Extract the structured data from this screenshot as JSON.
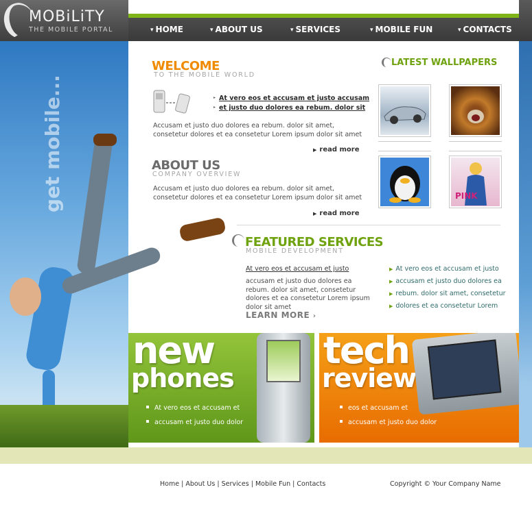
{
  "header": {
    "logo_title": "MOBiLiTY",
    "logo_subtitle": "THE MOBILE PORTAL",
    "nav": [
      {
        "label": "HOME"
      },
      {
        "label": "ABOUT US"
      },
      {
        "label": "SERVICES"
      },
      {
        "label": "MOBILE FUN"
      },
      {
        "label": "CONTACTS"
      }
    ]
  },
  "hero": {
    "vertical_text": "get mobile..."
  },
  "welcome": {
    "title": "WELCOME",
    "subtitle": "TO THE MOBILE WORLD",
    "links": [
      "At vero eos et accusam et justo accusam",
      "et justo duo dolores ea rebum. dolor sit"
    ],
    "body": "Accusam et justo duo dolores ea rebum. dolor sit amet, consetetur dolores et ea consetetur Lorem ipsum dolor sit amet",
    "read_more": "read more"
  },
  "about": {
    "title": "ABOUT US",
    "subtitle": "COMPANY OVERVIEW",
    "body": "Accusam et justo duo dolores ea rebum. dolor sit amet, consetetur dolores et ea consetetur Lorem ipsum dolor sit amet",
    "read_more": "read more"
  },
  "wallpapers": {
    "title": "LATEST WALLPAPERS",
    "items": [
      {
        "subject": "silver sports car"
      },
      {
        "subject": "roaring lion"
      },
      {
        "subject": "penguin"
      },
      {
        "subject": "woman in blue"
      }
    ]
  },
  "services": {
    "title": "FEATURED SERVICES",
    "subtitle": "MOBILE DEVELOPMENT",
    "link": "At vero eos et accusam et justo",
    "body": "accusam et justo duo dolores ea rebum. dolor sit amet, consetetur dolores et ea consetetur Lorem ipsum dolor sit amet",
    "learn_more": "LEARN MORE",
    "list": [
      "At vero eos et accusam et justo",
      "accusam et justo duo dolores ea",
      "rebum. dolor sit amet, consetetur",
      "dolores et ea consetetur Lorem"
    ]
  },
  "promos": {
    "new_phones": {
      "title": "new",
      "subtitle": "phones",
      "items": [
        "At vero eos et accusam et",
        "accusam et justo duo dolor"
      ]
    },
    "tech_review": {
      "title": "tech",
      "subtitle": "review",
      "items": [
        "eos et accusam et",
        "accusam et justo duo dolor"
      ]
    }
  },
  "footer": {
    "links": [
      "Home",
      "About Us",
      "Services",
      "Mobile Fun",
      "Contacts"
    ],
    "copyright": "Copyright © Your Company Name"
  },
  "colors": {
    "accent_green": "#7fb519",
    "accent_orange": "#f08a00",
    "header_gray": "#4a4a4a"
  }
}
